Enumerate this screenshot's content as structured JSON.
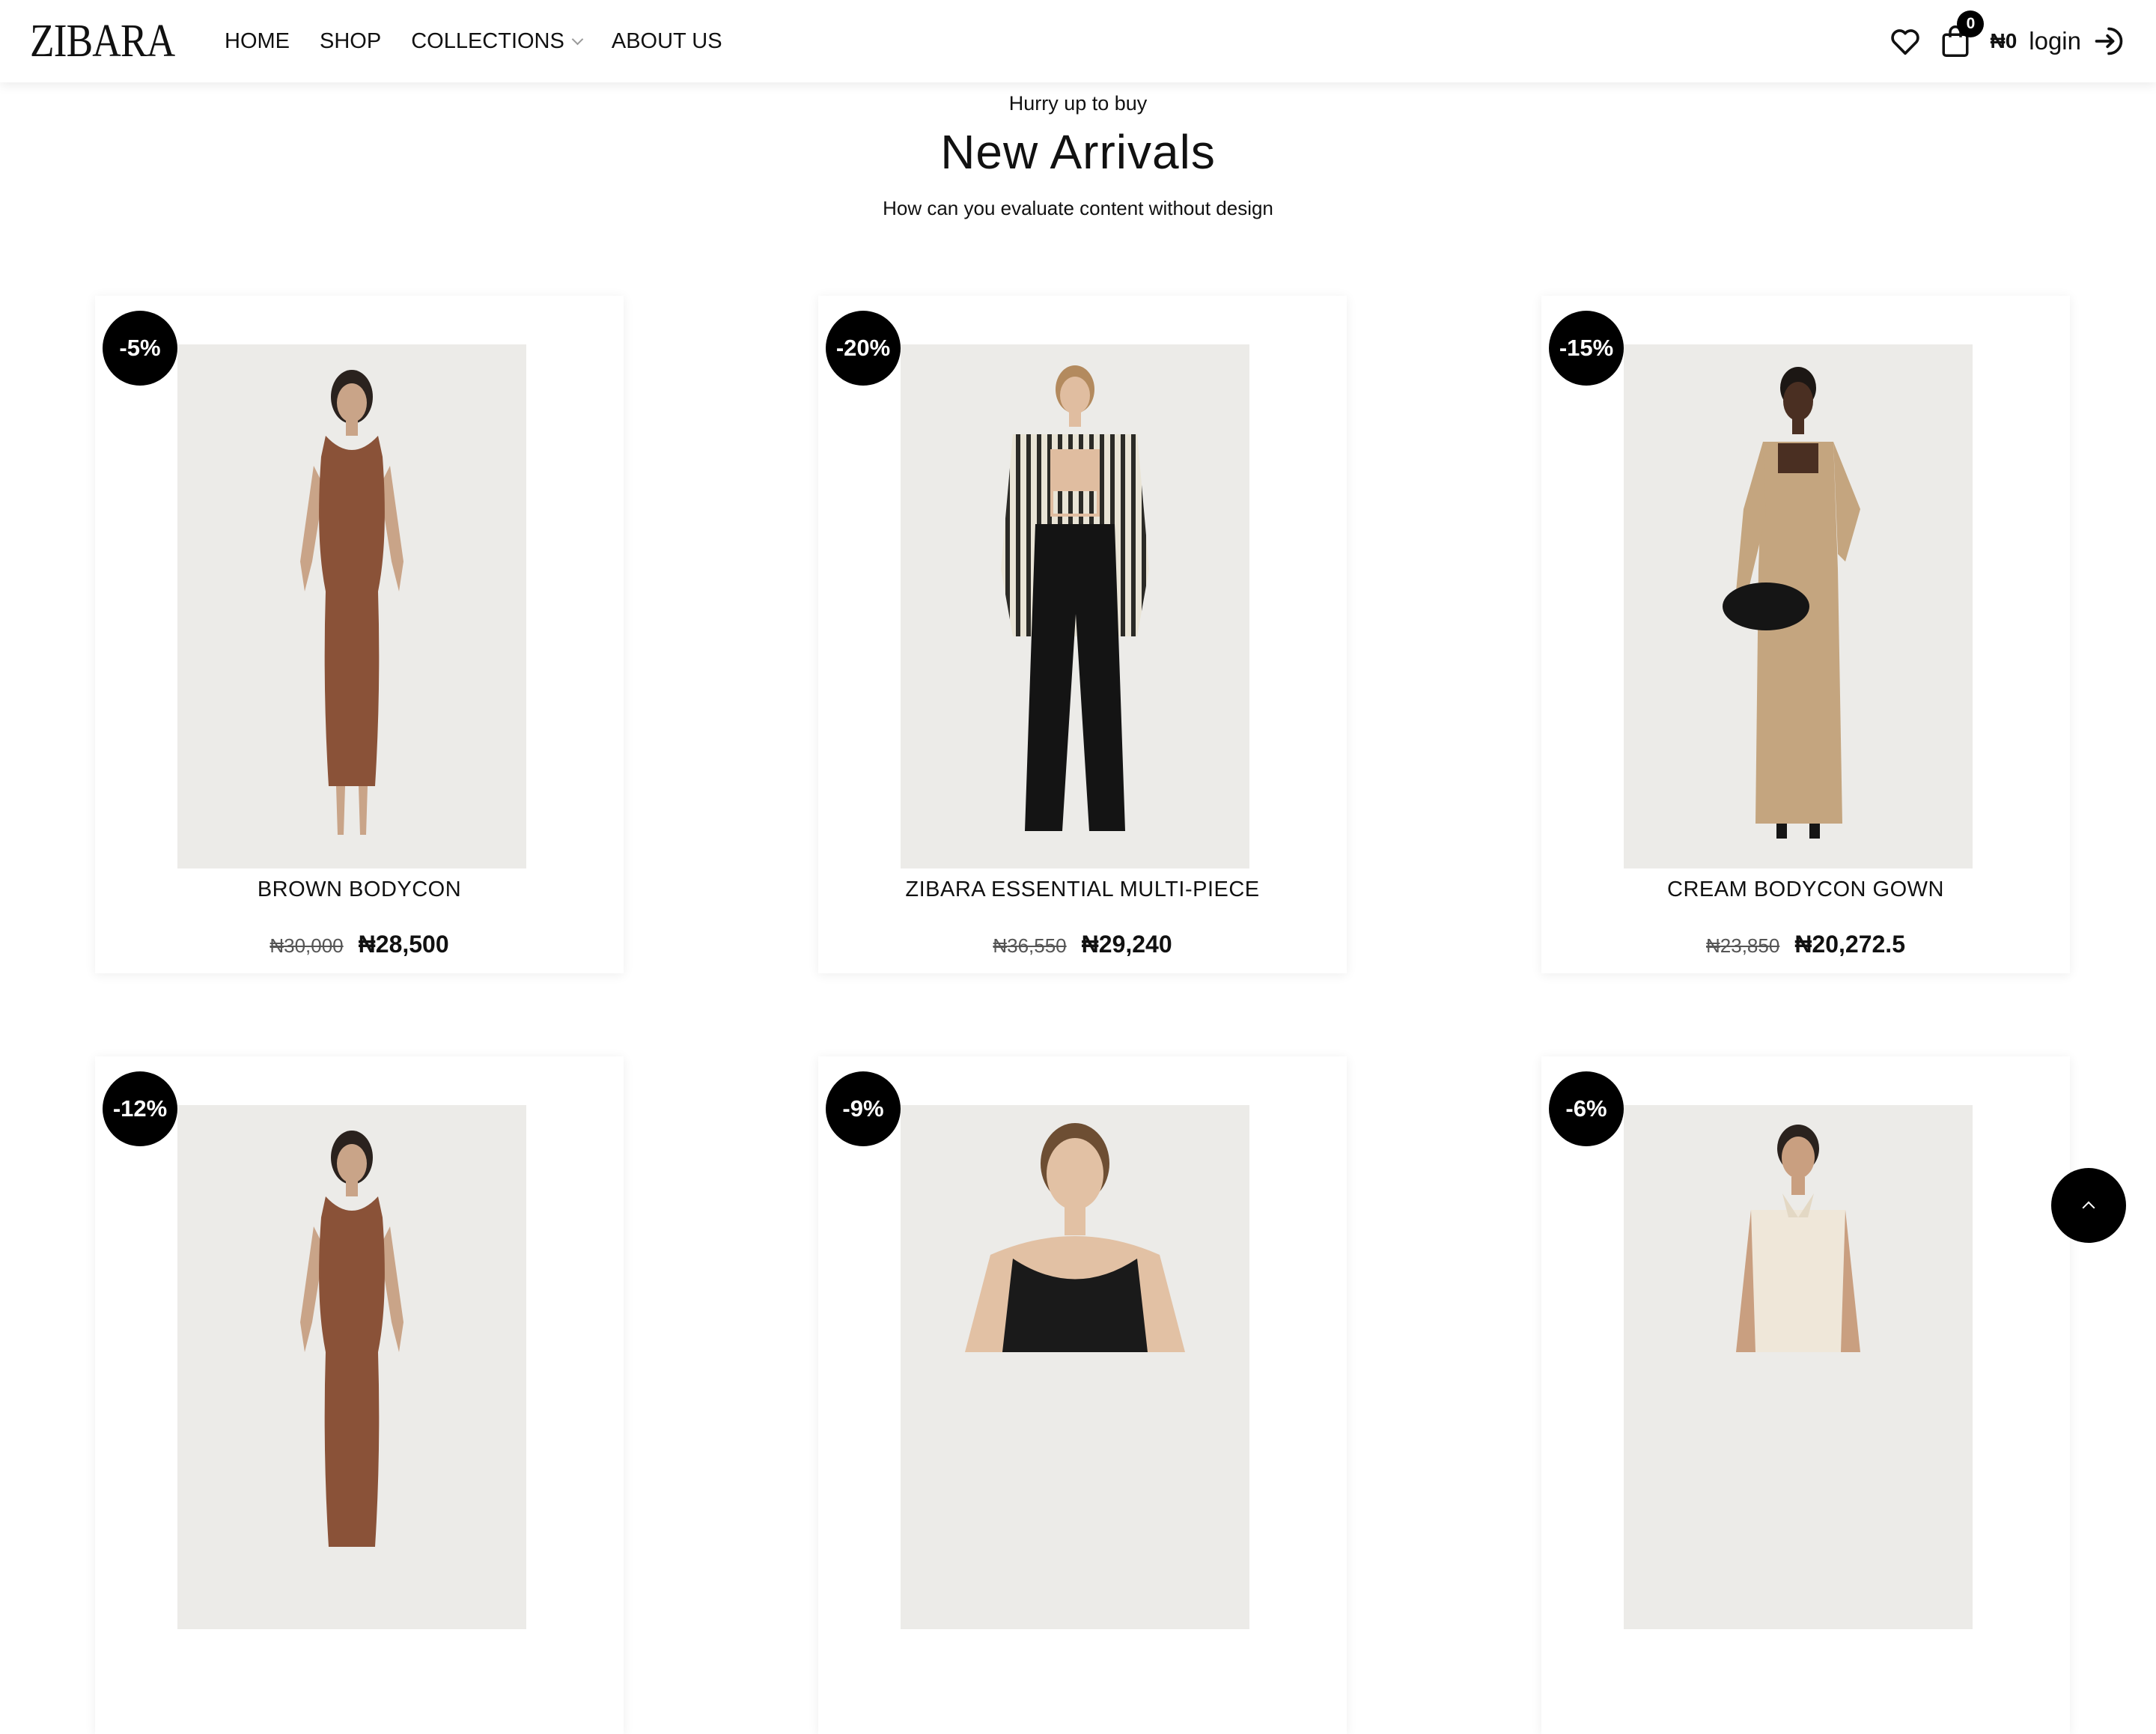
{
  "header": {
    "logo": "ZIBARA",
    "nav": [
      {
        "label": "HOME"
      },
      {
        "label": "SHOP"
      },
      {
        "label": "COLLECTIONS"
      },
      {
        "label": "ABOUT US"
      }
    ],
    "cart_count": "0",
    "cart_total": "₦0",
    "login_label": "login"
  },
  "section": {
    "subtitle": "Hurry up to buy",
    "title": "New Arrivals",
    "description": "How can you evaluate content without design"
  },
  "products": [
    {
      "discount": "-5%",
      "name": "BROWN BODYCON",
      "old_price": "₦30,000",
      "price": "₦28,500"
    },
    {
      "discount": "-20%",
      "name": "ZIBARA ESSENTIAL MULTI-PIECE",
      "old_price": "₦36,550",
      "price": "₦29,240"
    },
    {
      "discount": "-15%",
      "name": "CREAM BODYCON GOWN",
      "old_price": "₦23,850",
      "price": "₦20,272.5"
    },
    {
      "discount": "-12%",
      "name": "",
      "old_price": "",
      "price": ""
    },
    {
      "discount": "-9%",
      "name": "",
      "old_price": "",
      "price": ""
    },
    {
      "discount": "-6%",
      "name": "",
      "old_price": "",
      "price": ""
    }
  ],
  "icons": {
    "wishlist": "heart-icon",
    "cart": "shopping-bag-icon",
    "login": "sign-in-arrow-icon",
    "scroll_top": "chevron-up-icon"
  },
  "colors": {
    "badge": "#000000",
    "background": "#ffffff",
    "text": "#111111"
  }
}
